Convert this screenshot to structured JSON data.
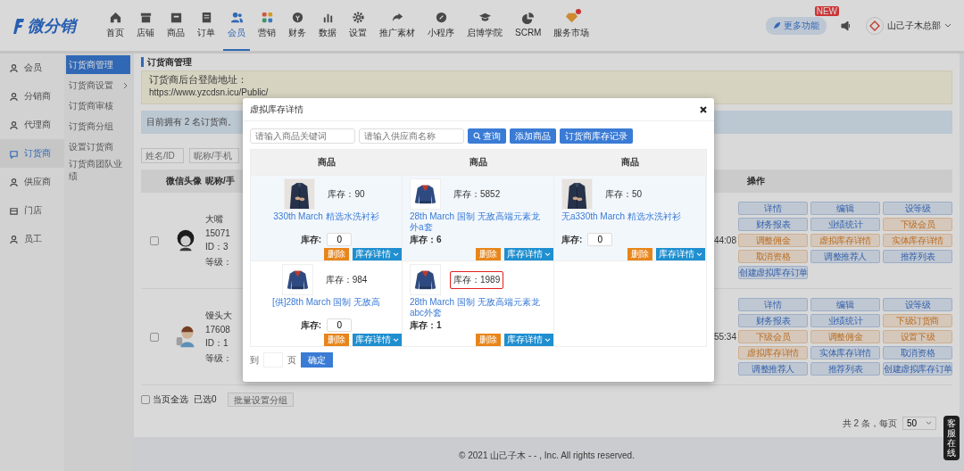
{
  "nav": {
    "logo": "微分销",
    "items": [
      {
        "label": "首页",
        "selected": false,
        "badge": false
      },
      {
        "label": "店铺",
        "selected": false,
        "badge": false
      },
      {
        "label": "商品",
        "selected": false,
        "badge": false
      },
      {
        "label": "订单",
        "selected": false,
        "badge": false
      },
      {
        "label": "会员",
        "selected": true,
        "badge": false
      },
      {
        "label": "营销",
        "selected": false,
        "badge": false
      },
      {
        "label": "财务",
        "selected": false,
        "badge": false
      },
      {
        "label": "数据",
        "selected": false,
        "badge": false
      },
      {
        "label": "设置",
        "selected": false,
        "badge": false
      },
      {
        "label": "推广素材",
        "selected": false,
        "badge": false
      },
      {
        "label": "小程序",
        "selected": false,
        "badge": false
      },
      {
        "label": "启博学院",
        "selected": false,
        "badge": false
      },
      {
        "label": "SCRM",
        "selected": false,
        "badge": false
      },
      {
        "label": "服务市场",
        "selected": false,
        "badge": true
      }
    ],
    "more": {
      "label": "更多功能",
      "badge": "NEW"
    },
    "account": "山己子木总部"
  },
  "sidebar": {
    "items": [
      {
        "label": "会员",
        "selected": false
      },
      {
        "label": "分销商",
        "selected": false
      },
      {
        "label": "代理商",
        "selected": false
      },
      {
        "label": "订货商",
        "selected": true
      },
      {
        "label": "供应商",
        "selected": false
      },
      {
        "label": "门店",
        "selected": false
      },
      {
        "label": "员工",
        "selected": false
      }
    ]
  },
  "subnav": {
    "items": [
      {
        "label": "订货商管理",
        "selected": true,
        "expandable": false
      },
      {
        "label": "订货商设置",
        "selected": false,
        "expandable": true
      },
      {
        "label": "订货商审核",
        "selected": false,
        "expandable": false
      },
      {
        "label": "订货商分组",
        "selected": false,
        "expandable": false
      },
      {
        "label": "设置订货商",
        "selected": false,
        "expandable": false
      },
      {
        "label": "订货商团队业绩",
        "selected": false,
        "expandable": false
      }
    ]
  },
  "page": {
    "title": "订货商管理",
    "login_label": "订货商后台登陆地址：",
    "login_url": "https://www.yzcdsn.icu/Public/",
    "notice": "目前拥有 2 名订货商。",
    "filters": [
      {
        "placeholder": "姓名/ID"
      },
      {
        "placeholder": "昵称/手机"
      }
    ]
  },
  "table": {
    "columns": [
      "微信头像",
      "昵称/手",
      "操作"
    ],
    "rows": [
      {
        "checked": false,
        "lines": [
          "大嘴",
          "15071",
          "ID：3",
          "等级："
        ],
        "time": "44:08",
        "actions": [
          {
            "label": "详情",
            "kind": "primary"
          },
          {
            "label": "编辑",
            "kind": "primary"
          },
          {
            "label": "设等级",
            "kind": "primary"
          },
          {
            "label": "财务报表",
            "kind": "primary"
          },
          {
            "label": "业绩统计",
            "kind": "primary"
          },
          {
            "label": "下级会员",
            "kind": "warning"
          },
          {
            "label": "调整佣金",
            "kind": "warning"
          },
          {
            "label": "虚拟库存详情",
            "kind": "warning"
          },
          {
            "label": "实体库存详情",
            "kind": "warning"
          },
          {
            "label": "取消资格",
            "kind": "warning"
          },
          {
            "label": "调整推荐人",
            "kind": "primary"
          },
          {
            "label": "推荐列表",
            "kind": "primary"
          },
          {
            "label": "创建虚拟库存订单",
            "kind": "primary"
          }
        ]
      },
      {
        "checked": false,
        "lines": [
          "馒头大",
          "17608",
          "ID：1",
          "等级："
        ],
        "time": "55:34",
        "actions": [
          {
            "label": "详情",
            "kind": "primary"
          },
          {
            "label": "编辑",
            "kind": "primary"
          },
          {
            "label": "设等级",
            "kind": "primary"
          },
          {
            "label": "财务报表",
            "kind": "primary"
          },
          {
            "label": "业绩统计",
            "kind": "primary"
          },
          {
            "label": "下级订货商",
            "kind": "warning"
          },
          {
            "label": "下级会员",
            "kind": "warning"
          },
          {
            "label": "调整佣金",
            "kind": "warning"
          },
          {
            "label": "设置下级",
            "kind": "warning"
          },
          {
            "label": "虚拟库存详情",
            "kind": "warning"
          },
          {
            "label": "实体库存详情",
            "kind": "primary"
          },
          {
            "label": "取消资格",
            "kind": "primary"
          },
          {
            "label": "调整推荐人",
            "kind": "primary"
          },
          {
            "label": "推荐列表",
            "kind": "primary"
          },
          {
            "label": "创建虚拟库存订单",
            "kind": "primary"
          }
        ]
      }
    ]
  },
  "bottom": {
    "select_all": {
      "label": "当页全选",
      "checked": false
    },
    "selected_count": "已选0",
    "batch_button": "批量设置分组"
  },
  "pagination": {
    "total": "共 2 条，每页",
    "page_size": "50"
  },
  "footer": "© 2021 山己子木 - - , Inc. All rights reserved.",
  "chat_tab": "客服在线",
  "modal": {
    "title": "虚拟库存详情",
    "search": [
      {
        "placeholder": "请输入商品关键词"
      },
      {
        "placeholder": "请输入供应商名称"
      }
    ],
    "buttons": [
      {
        "label": "查询",
        "kind": "search"
      },
      {
        "label": "添加商品",
        "kind": "plain"
      },
      {
        "label": "订货商库存记录",
        "kind": "plain"
      }
    ],
    "columns": [
      "商品",
      "商品",
      "商品"
    ],
    "rows": [
      {
        "hovered": true,
        "items": [
          {
            "kind": "input",
            "stock": "库存：90",
            "name": "330th March 精选水洗衬衫",
            "stock_label": "库存:",
            "stock_value": "0",
            "highlighted": false,
            "delete": "删除",
            "details": "库存详情"
          },
          {
            "kind": "text",
            "stock": "库存：5852",
            "name": "28th March 国制 无敌高端元素龙外a套",
            "stock_label": "库存：6",
            "highlighted": false,
            "delete": "删除",
            "details": "库存详情"
          },
          {
            "kind": "input",
            "stock": "库存：50",
            "name": "无a330th March 精选水洗衬衫",
            "stock_label": "库存:",
            "stock_value": "0",
            "highlighted": false,
            "delete": "删除",
            "details": "库存详情"
          }
        ]
      },
      {
        "hovered": false,
        "items": [
          {
            "kind": "input",
            "stock": "库存：984",
            "name": "[供]28th March 国制 无敌高",
            "stock_label": "库存:",
            "stock_value": "0",
            "highlighted": false,
            "delete": "删除",
            "details": "库存详情"
          },
          {
            "kind": "text",
            "stock": "库存：1989",
            "name": "28th March 国制 无敌高端元素龙abc外套",
            "stock_label": "库存：1",
            "highlighted": true,
            "delete": "删除",
            "details": "库存详情"
          }
        ]
      }
    ],
    "goto": {
      "before": "到",
      "after": "页",
      "button": "确定"
    }
  }
}
